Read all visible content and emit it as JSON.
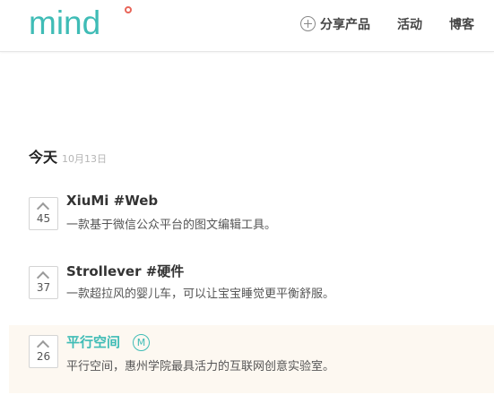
{
  "header": {
    "logo": "mind",
    "nav": {
      "share": "分享产品",
      "activity": "活动",
      "blog": "博客"
    }
  },
  "day": {
    "label": "今天",
    "date": "10月13日"
  },
  "products": [
    {
      "votes": "45",
      "title": "XiuMi #Web",
      "desc": "一款基于微信公众平台的图文编辑工具。"
    },
    {
      "votes": "37",
      "title": "Strollever #硬件",
      "desc": "一款超拉风的婴儿车，可以让宝宝睡觉更平衡舒服。"
    },
    {
      "votes": "26",
      "title": "平行空间",
      "badge": "M",
      "desc": "平行空间，惠州学院最具活力的互联网创意实验室。"
    }
  ]
}
